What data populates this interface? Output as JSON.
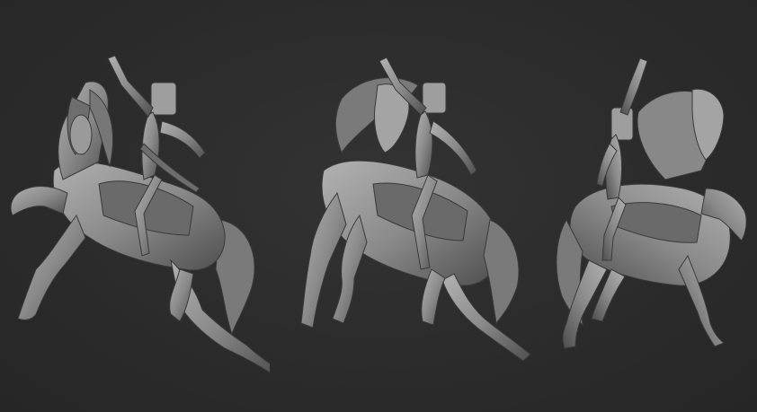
{
  "scene": {
    "background_color": "#2b2b2b",
    "clay_color": "#8e8e8e",
    "clay_shadow": "#4a4a4a",
    "clay_highlight": "#b4b4b4",
    "views": [
      {
        "id": "left",
        "description_name": "rearing-horse-rider-three-quarter-front"
      },
      {
        "id": "center",
        "description_name": "rearing-horse-rider-front"
      },
      {
        "id": "right",
        "description_name": "rearing-horse-rider-rear"
      }
    ]
  }
}
